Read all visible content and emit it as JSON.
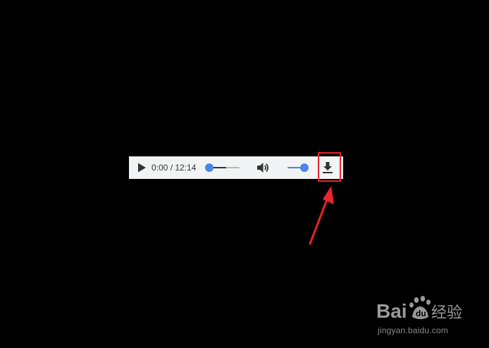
{
  "player": {
    "current_time": "0:00",
    "duration": "12:14",
    "time_separator": " / ",
    "progress_fraction": 0.0,
    "buffered_fraction": 0.55,
    "volume_fraction": 1.0,
    "accent_color": "#4a86e8",
    "background_color": "#f1f3f4",
    "play_icon": "play-icon",
    "volume_icon": "volume-icon",
    "download_icon": "download-icon"
  },
  "annotation": {
    "highlight_color": "#e8242c",
    "target": "download-button"
  },
  "watermark": {
    "brand_text": "Baidu经验",
    "url": "jingyan.baidu.com"
  }
}
